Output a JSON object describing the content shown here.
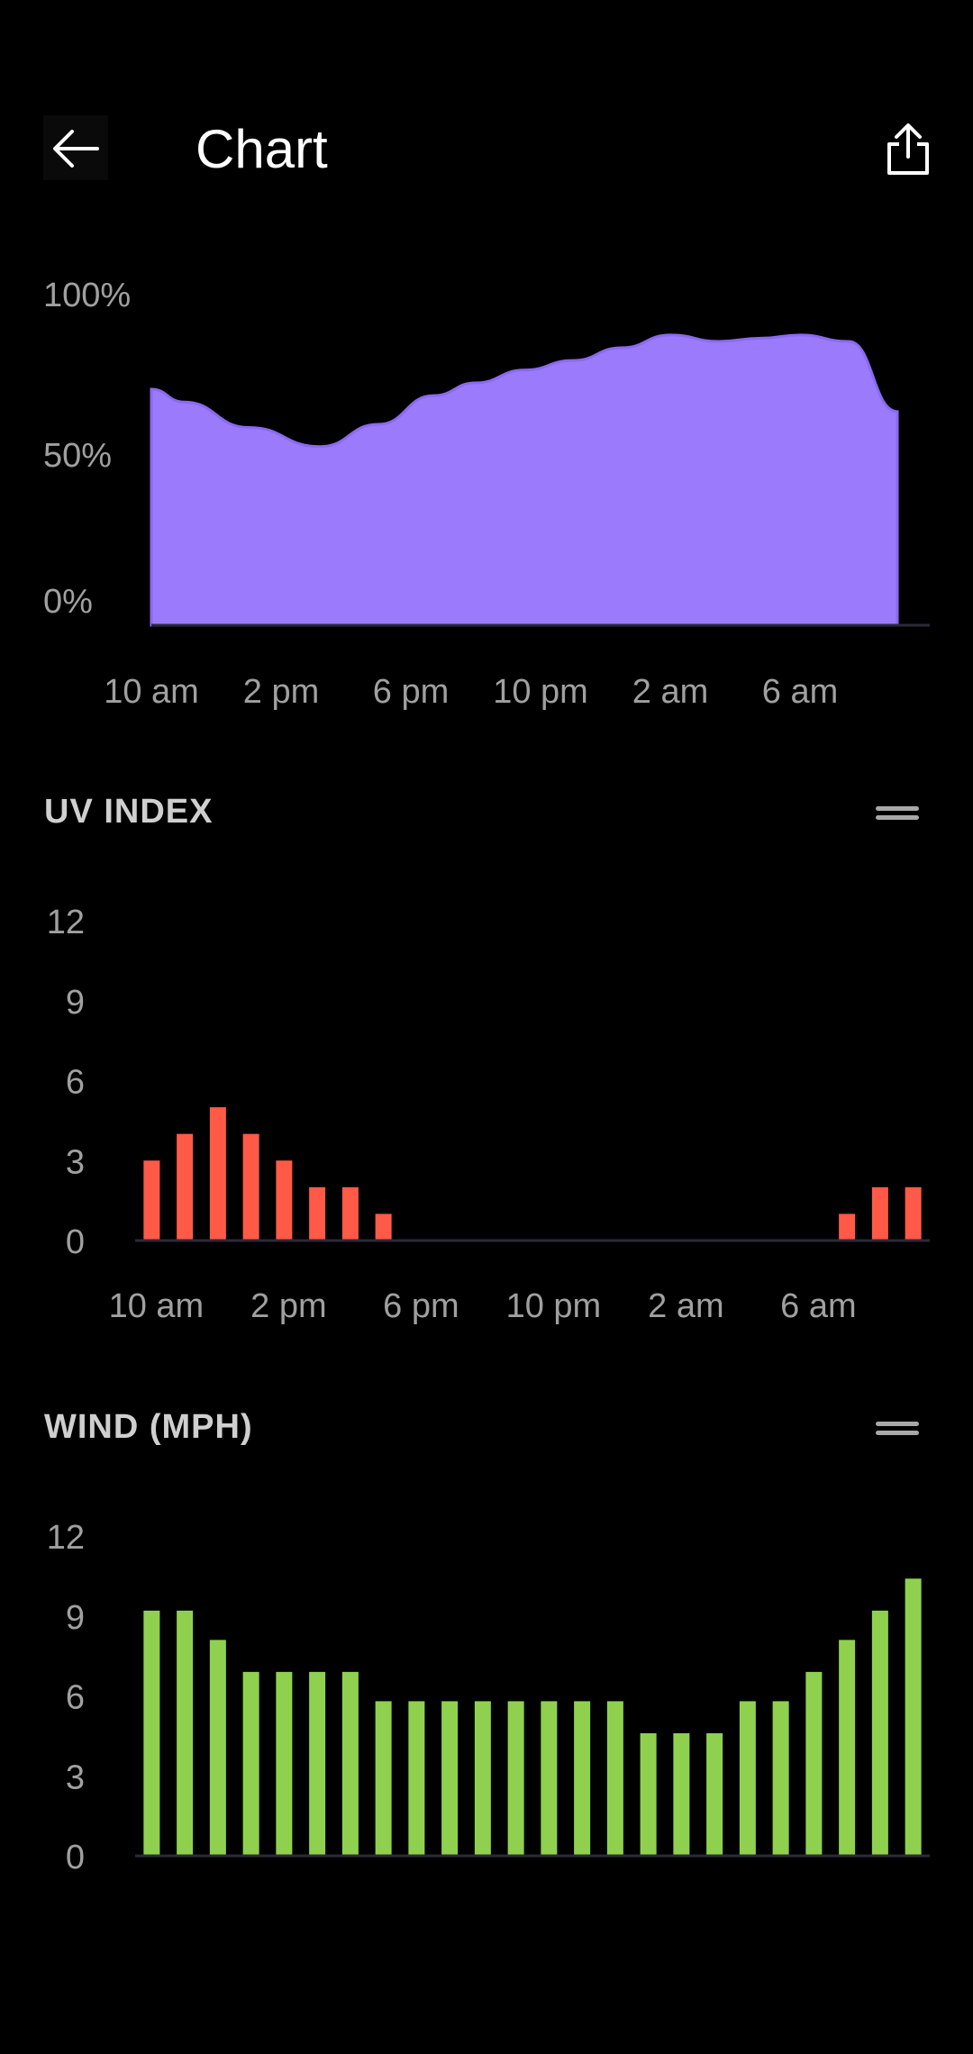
{
  "header": {
    "title": "Chart"
  },
  "icons": {
    "back": "arrow-left-icon",
    "share": "share-icon",
    "handle": "drag-handle-icon"
  },
  "colors": {
    "background": "#000000",
    "area": "#9b7bfc",
    "uv": "#ff5a47",
    "wind": "#8fd14f",
    "axis_text": "#a0a0a0"
  },
  "sections": {
    "uv": {
      "title": "UV INDEX"
    },
    "wind": {
      "title": "WIND (MPH)"
    }
  },
  "chart_data": [
    {
      "type": "area",
      "x_ticks": [
        "10 am",
        "2 pm",
        "6 pm",
        "10 pm",
        "2 am",
        "6 am"
      ],
      "y_ticks": [
        "100%",
        "50%",
        "0%"
      ],
      "ylim": [
        0,
        100
      ],
      "x_count": 24,
      "values": [
        74,
        70,
        62,
        56,
        63,
        72,
        76,
        80,
        83,
        87,
        91,
        89,
        90,
        91,
        89,
        67
      ],
      "value_x": [
        0,
        1,
        3,
        5.2,
        7,
        8.7,
        10,
        11.5,
        13,
        14.5,
        16,
        17.5,
        18.8,
        20,
        21.5,
        23
      ]
    },
    {
      "type": "bar",
      "x_ticks": [
        "10 am",
        "2 pm",
        "6 pm",
        "10 pm",
        "2 am",
        "6 am"
      ],
      "y_ticks": [
        "12",
        "9",
        "6",
        "3",
        "0"
      ],
      "ylim": [
        0,
        12
      ],
      "series": [
        {
          "values": [
            3,
            4,
            5,
            4,
            3,
            2,
            2,
            1,
            0,
            0,
            0,
            0,
            0,
            0,
            0,
            0,
            0,
            0,
            0,
            0,
            0,
            1,
            2,
            2
          ]
        }
      ]
    },
    {
      "type": "bar",
      "x_ticks": [
        "10 am",
        "2 pm",
        "6 pm",
        "10 pm",
        "2 am",
        "6 am"
      ],
      "y_ticks": [
        "12",
        "9",
        "6",
        "3",
        "0"
      ],
      "ylim": [
        0,
        12
      ],
      "series": [
        {
          "values": [
            9.2,
            9.2,
            8.1,
            6.9,
            6.9,
            6.9,
            6.9,
            5.8,
            5.8,
            5.8,
            5.8,
            5.8,
            5.8,
            5.8,
            5.8,
            4.6,
            4.6,
            4.6,
            5.8,
            5.8,
            6.9,
            8.1,
            9.2,
            10.4
          ]
        }
      ]
    }
  ]
}
